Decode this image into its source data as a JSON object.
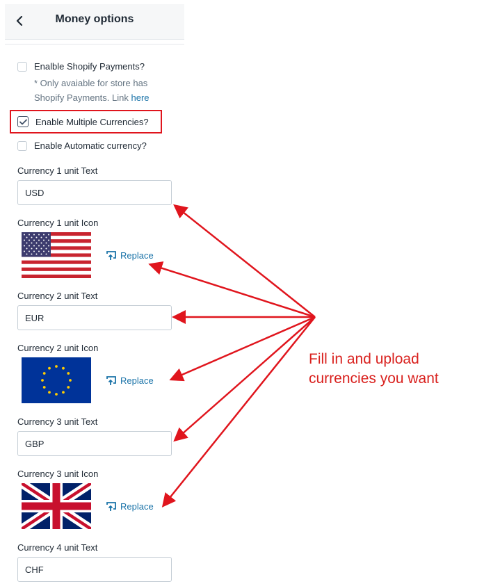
{
  "header": {
    "title": "Money options"
  },
  "options": {
    "shopify_payments_label": "Enalble Shopify Payments?",
    "shopify_note_line1": "* Only avaiable for store has",
    "shopify_note_line2": "Shopify Payments. Link",
    "shopify_note_link": "here",
    "multi_currency_label": "Enable Multiple Currencies?",
    "auto_currency_label": "Enable Automatic currency?"
  },
  "currencies": [
    {
      "text_label": "Currency 1 unit Text",
      "value": "USD",
      "icon_label": "Currency 1 unit Icon",
      "flag": "us-flag-icon",
      "replace_label": "Replace"
    },
    {
      "text_label": "Currency 2 unit Text",
      "value": "EUR",
      "icon_label": "Currency 2 unit Icon",
      "flag": "eu-flag-icon",
      "replace_label": "Replace"
    },
    {
      "text_label": "Currency 3 unit Text",
      "value": "GBP",
      "icon_label": "Currency 3 unit Icon",
      "flag": "uk-flag-icon",
      "replace_label": "Replace"
    },
    {
      "text_label": "Currency 4 unit Text",
      "value": "CHF"
    }
  ],
  "annotation": {
    "line1": "Fill in and upload",
    "line2": "currencies you want",
    "color": "#d9211e"
  },
  "colors": {
    "link": "#1a73a8",
    "highlight_border": "#e0151d"
  }
}
